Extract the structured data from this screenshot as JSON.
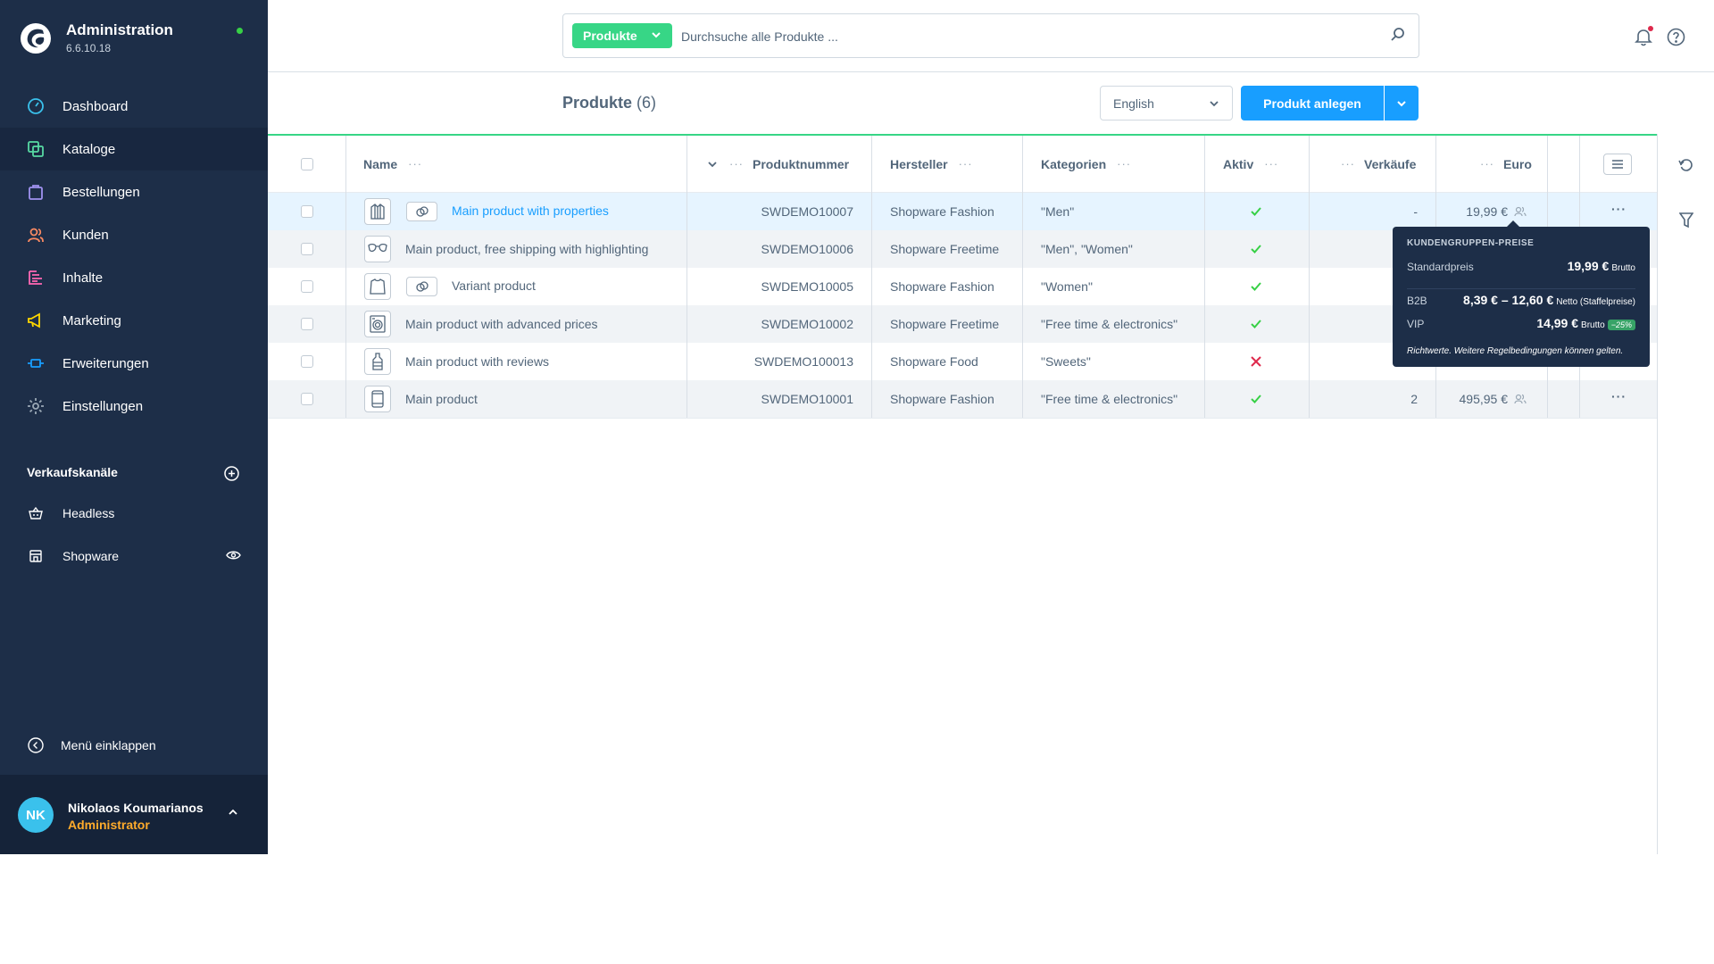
{
  "brand": {
    "title": "Administration",
    "version": "6.6.10.18",
    "status_color": "#37d046"
  },
  "sidebar": {
    "items": [
      {
        "label": "Dashboard",
        "icon": "dashboard-icon",
        "color": "#3ac1ec"
      },
      {
        "label": "Kataloge",
        "icon": "catalog-icon",
        "color": "#57d9a3"
      },
      {
        "label": "Bestellungen",
        "icon": "orders-icon",
        "color": "#a092f0"
      },
      {
        "label": "Kunden",
        "icon": "customers-icon",
        "color": "#f88962"
      },
      {
        "label": "Inhalte",
        "icon": "content-icon",
        "color": "#ff68b4"
      },
      {
        "label": "Marketing",
        "icon": "marketing-icon",
        "color": "#ffd700"
      },
      {
        "label": "Erweiterungen",
        "icon": "extensions-icon",
        "color": "#189eff"
      },
      {
        "label": "Einstellungen",
        "icon": "settings-icon",
        "color": "#9aa8b5"
      }
    ],
    "channels_title": "Verkaufskanäle",
    "channels": [
      {
        "label": "Headless",
        "icon": "basket-icon"
      },
      {
        "label": "Shopware",
        "icon": "storefront-icon"
      }
    ],
    "collapse_label": "Menü einklappen",
    "user": {
      "initials": "NK",
      "name": "Nikolaos Koumarianos",
      "role": "Administrator"
    }
  },
  "search": {
    "type_label": "Produkte",
    "placeholder": "Durchsuche alle Produkte ..."
  },
  "page": {
    "title": "Produkte",
    "count": "(6)",
    "language": "English",
    "create_label": "Produkt anlegen"
  },
  "table": {
    "columns": [
      "Name",
      "Produktnummer",
      "Hersteller",
      "Kategorien",
      "Aktiv",
      "Verkäufe",
      "Euro"
    ],
    "rows": [
      {
        "name": "Main product with properties",
        "number": "SWDEMO10007",
        "manufacturer": "Shopware Fashion",
        "categories": "\"Men\"",
        "active": true,
        "sales": "-",
        "price": "19,99 €",
        "thumb": "jacket-icon",
        "variant": true
      },
      {
        "name": "Main product, free shipping with highlighting",
        "number": "SWDEMO10006",
        "manufacturer": "Shopware Freetime",
        "categories": "\"Men\", \"Women\"",
        "active": true,
        "sales": "",
        "price": "",
        "thumb": "sunglasses-icon",
        "variant": false
      },
      {
        "name": "Variant product",
        "number": "SWDEMO10005",
        "manufacturer": "Shopware Fashion",
        "categories": "\"Women\"",
        "active": true,
        "sales": "",
        "price": "",
        "thumb": "shirt-icon",
        "variant": true
      },
      {
        "name": "Main product with advanced prices",
        "number": "SWDEMO10002",
        "manufacturer": "Shopware Freetime",
        "categories": "\"Free time & electronics\"",
        "active": true,
        "sales": "",
        "price": "",
        "thumb": "washer-icon",
        "variant": false
      },
      {
        "name": "Main product with reviews",
        "number": "SWDEMO100013",
        "manufacturer": "Shopware Food",
        "categories": "\"Sweets\"",
        "active": false,
        "sales": "",
        "price": "",
        "thumb": "bottle-icon",
        "variant": false
      },
      {
        "name": "Main product",
        "number": "SWDEMO10001",
        "manufacturer": "Shopware Fashion",
        "categories": "\"Free time & electronics\"",
        "active": true,
        "sales": "2",
        "price": "495,95 €",
        "thumb": "phone-icon",
        "variant": false
      }
    ]
  },
  "tooltip": {
    "title": "KUNDENGRUPPEN-PREISE",
    "standard_label": "Standardpreis",
    "standard_value": "19,99 €",
    "standard_suffix": "Brutto",
    "b2b_label": "B2B",
    "b2b_value": "8,39 € – 12,60 €",
    "b2b_suffix": "Netto (Staffelpreise)",
    "vip_label": "VIP",
    "vip_value": "14,99 €",
    "vip_suffix": "Brutto",
    "vip_badge": "−25%",
    "note": "Richtwerte. Weitere Regelbedingungen können gelten."
  },
  "colors": {
    "primary": "#189eff",
    "sidebar": "#1d2e48",
    "accent": "#37d686",
    "success": "#37d046",
    "danger": "#de294c",
    "role": "#ffab2b"
  }
}
